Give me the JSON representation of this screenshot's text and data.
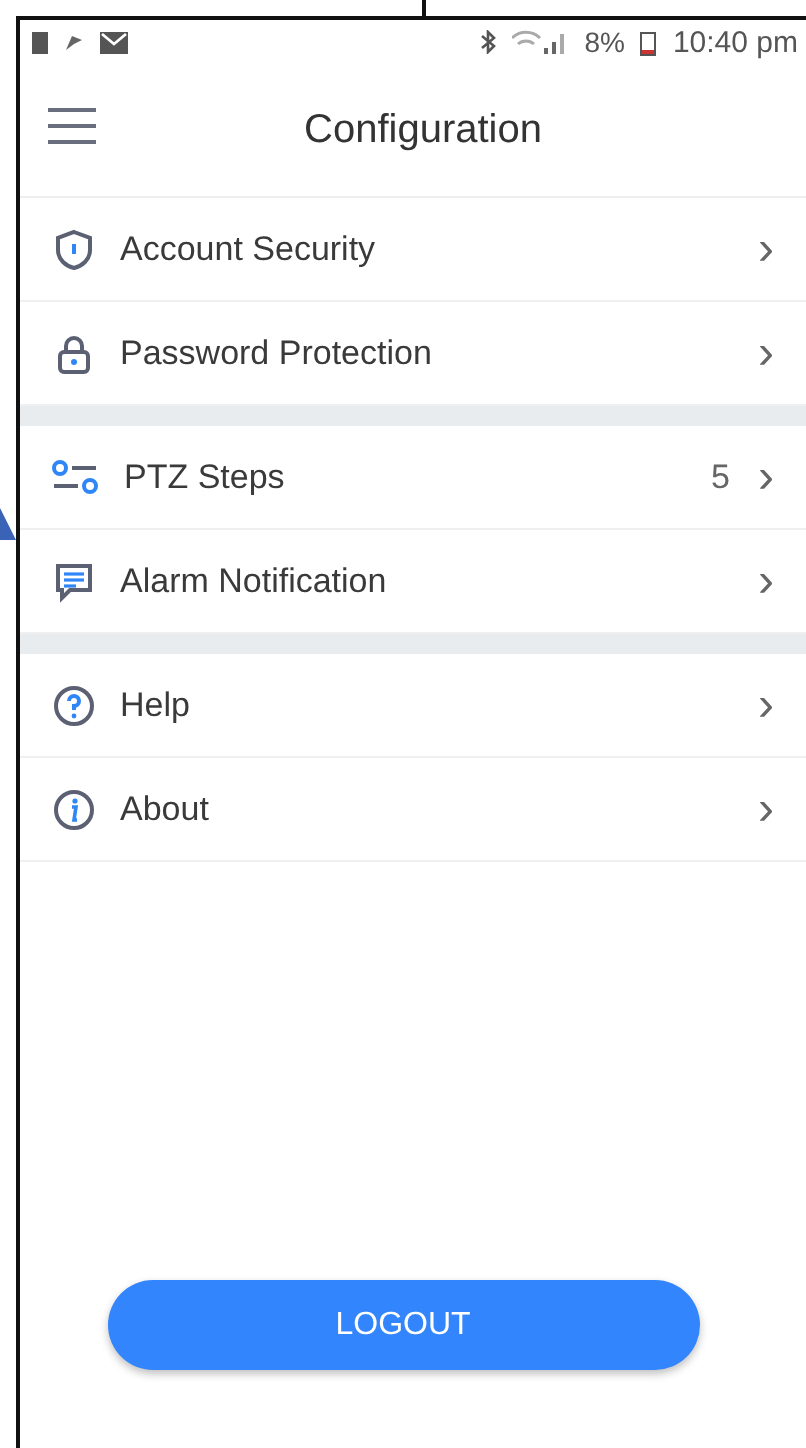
{
  "status_bar": {
    "battery": "8%",
    "time": "10:40 pm"
  },
  "header": {
    "title": "Configuration"
  },
  "sections": [
    {
      "items": [
        {
          "label": "Account Security",
          "chevron": "›"
        },
        {
          "label": "Password Protection",
          "chevron": "›"
        }
      ]
    },
    {
      "items": [
        {
          "label": "PTZ Steps",
          "value": "5",
          "chevron": "›"
        },
        {
          "label": "Alarm Notification",
          "chevron": "›"
        }
      ]
    },
    {
      "items": [
        {
          "label": "Help",
          "chevron": "›"
        },
        {
          "label": "About",
          "chevron": "›"
        }
      ]
    }
  ],
  "logout_button": {
    "label": "LOGOUT"
  }
}
